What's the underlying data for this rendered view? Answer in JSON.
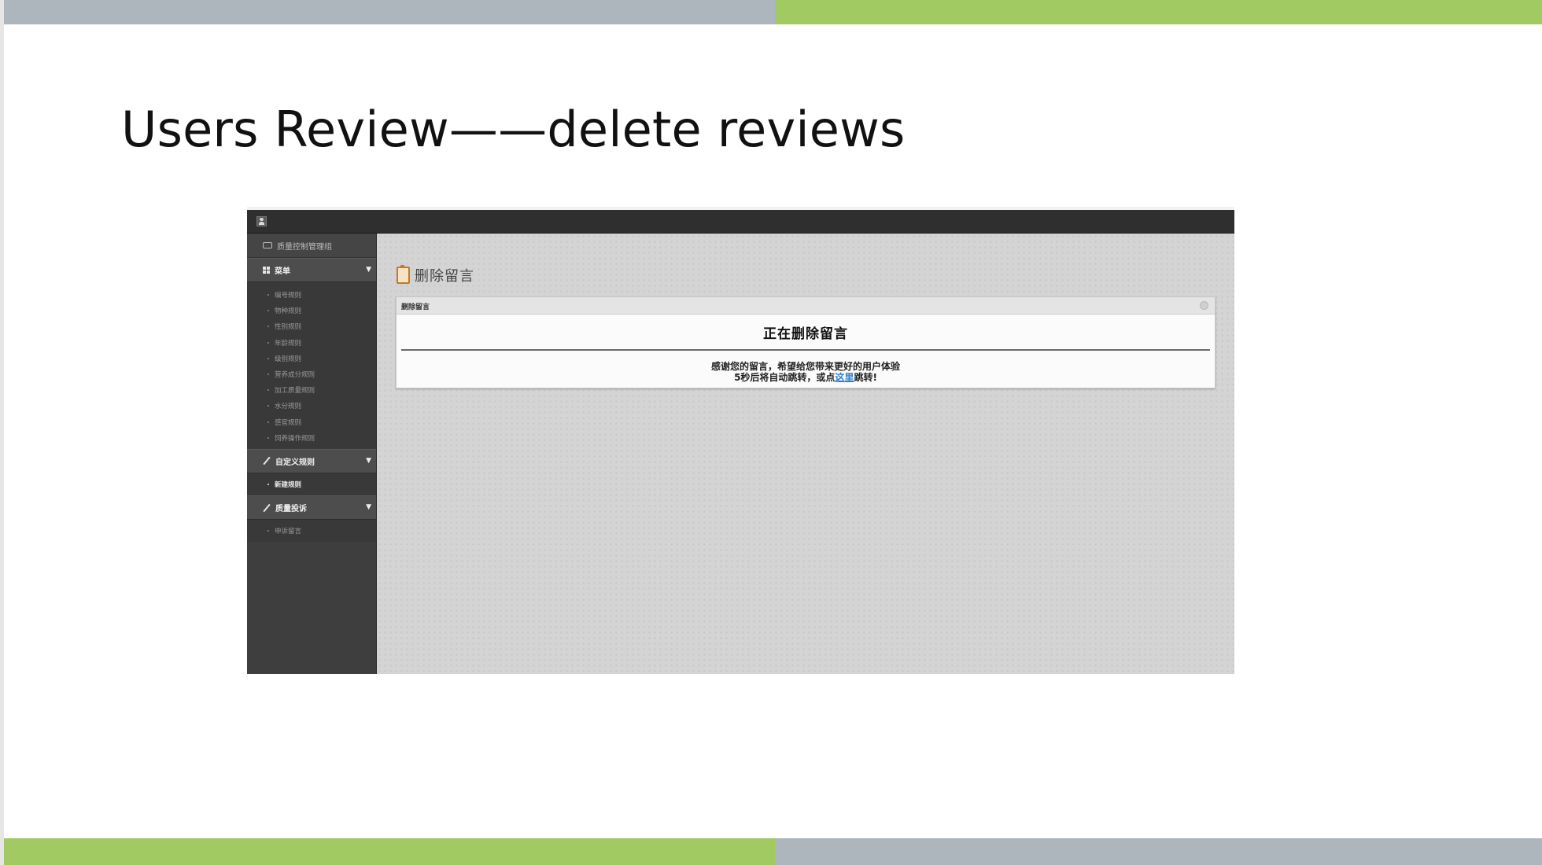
{
  "slide": {
    "title": "Users Review——delete reviews",
    "colors": {
      "green": "#a1cb62",
      "gray": "#adb5bd"
    }
  },
  "app": {
    "sidebar": {
      "brand": "质量控制管理组",
      "sections": [
        {
          "label": "菜单",
          "icon": "grid-icon",
          "items": [
            "编号规则",
            "物种规则",
            "性别规则",
            "年龄规则",
            "级别规则",
            "营养成分规则",
            "加工质量规则",
            "水分规则",
            "感官规则",
            "饲养操作规则"
          ]
        },
        {
          "label": "自定义规则",
          "icon": "pencil-icon",
          "items": [
            "新建规则"
          ]
        },
        {
          "label": "质量投诉",
          "icon": "pencil-icon",
          "items": [
            "申诉留言"
          ]
        }
      ]
    },
    "main": {
      "page_title": "删除留言",
      "panel": {
        "bar_label": "删除留言",
        "heading": "正在删除留言",
        "message_line1": "感谢您的留言，希望给您带来更好的用户体验",
        "message_line2_pre": "5秒后将自动跳转，或点",
        "message_link": "这里",
        "message_line2_post": "跳转!"
      }
    }
  }
}
